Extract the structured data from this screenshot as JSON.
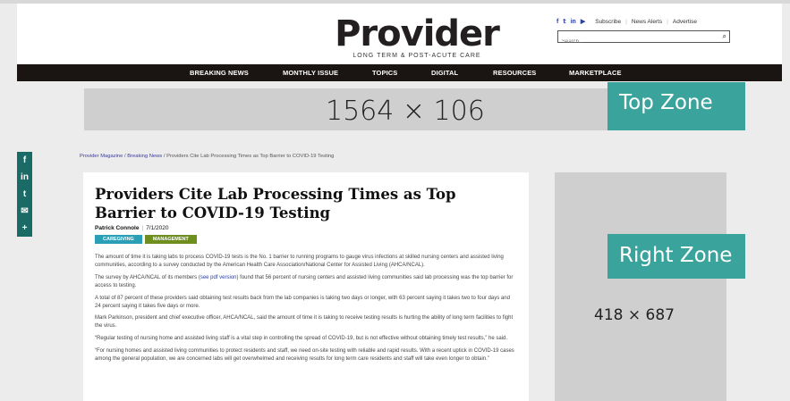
{
  "header": {
    "logo_word": "Provider",
    "logo_sub": "LONG TERM & POST-ACUTE CARE",
    "social": [
      "f",
      "𝕥",
      "in",
      "▶"
    ],
    "util_links": [
      "Subscribe",
      "News Alerts",
      "Advertise"
    ],
    "search_placeholder": "Search..."
  },
  "nav": {
    "items": [
      "BREAKING NEWS",
      "MONTHLY ISSUE",
      "TOPICS",
      "DIGITAL",
      "RESOURCES",
      "MARKETPLACE"
    ]
  },
  "ads": {
    "top_dims": "1564 × 106",
    "top_zone": "Top Zone",
    "right_dims": "418 × 687",
    "right_zone": "Right Zone"
  },
  "share": [
    "f",
    "in",
    "t",
    "✉",
    "+"
  ],
  "breadcrumb": {
    "home": "Provider Magazine",
    "section": "Breaking News",
    "current": "Providers Cite Lab Processing Times as Top Barrier to COVID-19 Testing",
    "sep": "/"
  },
  "article": {
    "title": "Providers Cite Lab Processing Times as Top Barrier to COVID-19 Testing",
    "author": "Patrick Connole",
    "date": "7/1/2020",
    "tags": [
      "CAREGIVING",
      "MANAGEMENT"
    ],
    "p1": "The amount of time it is taking labs to process COVID-19 tests is the No. 1 barrier to running programs to gauge virus infections at skilled nursing centers and assisted living communities, according to a survey conducted by the American Health Care Association/National Center for Assisted Living (AHCA/NCAL).",
    "p2_a": "The survey by AHCA/NCAL of its members (",
    "p2_link": "see pdf version",
    "p2_b": ") found that 56 percent of nursing centers and assisted living communities said lab processing was the top barrier for access to testing.",
    "p3": "A total of 87 percent of these providers said obtaining test results back from the lab companies is taking two days or longer, with 63 percent saying it takes two to four days and 24 percent saying it takes five days or more.",
    "p4": "Mark Parkinson, president and chief executive officer, AHCA/NCAL, said the amount of time it is taking to receive testing results is hurting the ability of long term facilities to fight the virus.",
    "p5": "“Regular testing of nursing home and assisted living staff is a vital step in controlling the spread of COVID-19, but is not effective without obtaining timely test results,” he said.",
    "p6": "“For nursing homes and assisted living communities to protect residents and staff, we need on-site testing with reliable and rapid results. With a recent uptick in COVID-19 cases among the general population, we are concerned labs will get overwhelmed and receiving results for long term care residents and staff will take even longer to obtain.”"
  }
}
